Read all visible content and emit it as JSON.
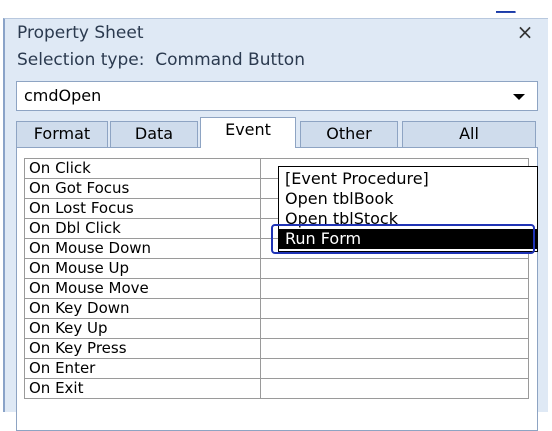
{
  "top": {
    "link_text": "___"
  },
  "panel": {
    "title": "Property Sheet",
    "close_glyph": "×",
    "selection_type_label": "Selection type:  Command Button",
    "object_combo_value": "cmdOpen"
  },
  "tabs": [
    {
      "label": "Format",
      "active": false
    },
    {
      "label": "Data",
      "active": false
    },
    {
      "label": "Event",
      "active": true
    },
    {
      "label": "Other",
      "active": false
    },
    {
      "label": "All",
      "active": false
    }
  ],
  "properties": [
    {
      "name": "On Click",
      "value": ""
    },
    {
      "name": "On Got Focus",
      "value": ""
    },
    {
      "name": "On Lost Focus",
      "value": ""
    },
    {
      "name": "On Dbl Click",
      "value": ""
    },
    {
      "name": "On Mouse Down",
      "value": ""
    },
    {
      "name": "On Mouse Up",
      "value": ""
    },
    {
      "name": "On Mouse Move",
      "value": ""
    },
    {
      "name": "On Key Down",
      "value": ""
    },
    {
      "name": "On Key Up",
      "value": ""
    },
    {
      "name": "On Key Press",
      "value": ""
    },
    {
      "name": "On Enter",
      "value": ""
    },
    {
      "name": "On Exit",
      "value": ""
    }
  ],
  "dropdown": {
    "builder_glyph": "...",
    "items": [
      "[Event Procedure]",
      "Open tblBook",
      "Open tblStock",
      "Run Form"
    ],
    "selected_index": 3
  },
  "colors": {
    "panel_bg": "#dfe9f5",
    "selected_bg": "#000000",
    "highlight_border": "#1f33b5"
  }
}
